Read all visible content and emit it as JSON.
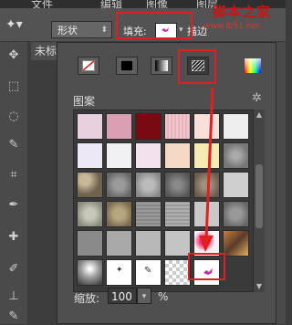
{
  "menubar": {
    "items": [
      "文件",
      "编辑",
      "图像",
      "图层"
    ]
  },
  "options_bar": {
    "shape_mode": "形状",
    "fill_label": "填充:",
    "stroke_label": "描边"
  },
  "watermark": {
    "title": "脚本之家",
    "url": "www.jb51.net"
  },
  "doc_tab": "未标",
  "fill_type_buttons": [
    "no-color",
    "solid-color",
    "gradient",
    "pattern"
  ],
  "panel": {
    "section_title": "图案",
    "zoom_label": "缩放:",
    "zoom_value": "100",
    "zoom_unit": "%"
  },
  "colors": {
    "accent_red": "#e02020",
    "panel_bg": "#4f4f4f"
  }
}
